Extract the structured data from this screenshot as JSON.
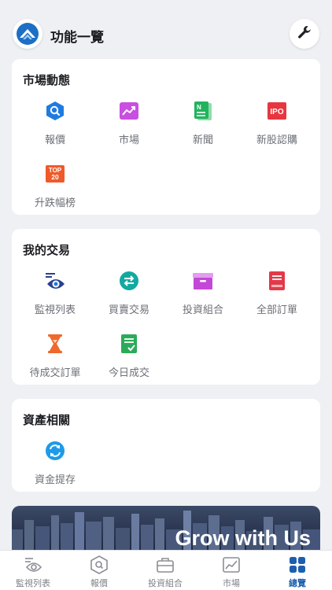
{
  "header": {
    "title": "功能一覽"
  },
  "sections": {
    "market": {
      "title": "市場動態",
      "items": [
        "報價",
        "市場",
        "新聞",
        "新股認購",
        "升跌幅榜"
      ],
      "ipo_badge": "IPO",
      "top20_badge_line1": "TOP",
      "top20_badge_line2": "20"
    },
    "trading": {
      "title": "我的交易",
      "items": [
        "監視列表",
        "買賣交易",
        "投資組合",
        "全部訂單",
        "待成交訂單",
        "今日成交"
      ]
    },
    "assets": {
      "title": "資產相關",
      "items": [
        "資金提存"
      ]
    }
  },
  "banner": {
    "text": "Grow with Us"
  },
  "tabbar": {
    "tabs": [
      "監視列表",
      "報價",
      "投資組合",
      "市場",
      "總覽"
    ],
    "active": "總覽"
  },
  "colors": {
    "accent": "#1c5fae",
    "quote_icon": "#1f7be0",
    "market_icon": "#c84fe0",
    "news_icon": "#22b35e",
    "ipo_icon": "#e8363f",
    "top20_icon": "#f05a28",
    "exchange_icon": "#12a9a0",
    "portfolio_icon": "#c448d8",
    "orders_icon": "#e33a49",
    "pending_icon": "#f0682c",
    "today_icon": "#2bab5a",
    "funds_icon": "#1e9be8"
  }
}
